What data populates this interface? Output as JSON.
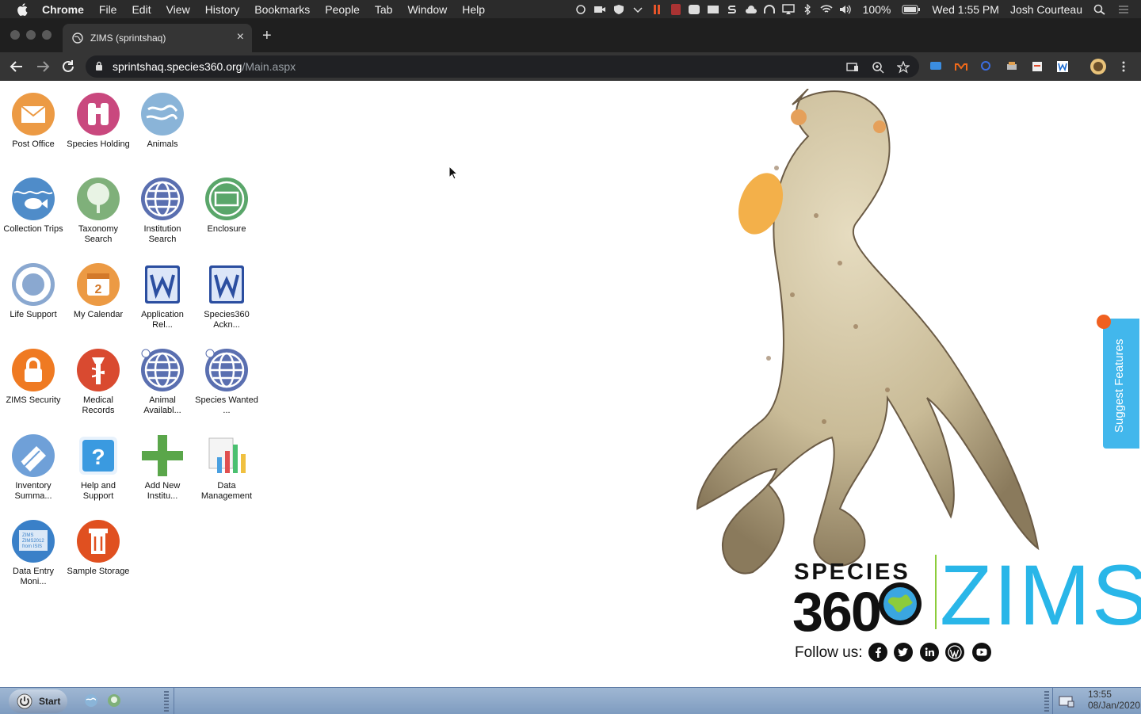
{
  "menubar": {
    "app_name": "Chrome",
    "items": [
      "File",
      "Edit",
      "View",
      "History",
      "Bookmarks",
      "People",
      "Tab",
      "Window",
      "Help"
    ],
    "battery": "100%",
    "datetime": "Wed 1:55 PM",
    "user": "Josh Courteau"
  },
  "browser": {
    "tab_title": "ZIMS (sprintshaq)",
    "url_host": "sprintshaq.species360.org",
    "url_path": "/Main.aspx"
  },
  "apps": [
    {
      "label": "Post Office",
      "icon": "envelope-icon",
      "color": "#e8923a"
    },
    {
      "label": "Species Holding",
      "icon": "binoculars-icon",
      "color": "#c9487e"
    },
    {
      "label": "Animals",
      "icon": "animals-globe-icon",
      "color": "#8ab4d8"
    },
    {
      "label": "Collection Trips",
      "icon": "fish-icon",
      "color": "#4f8cc9"
    },
    {
      "label": "Taxonomy Search",
      "icon": "tree-icon",
      "color": "#7fb07a"
    },
    {
      "label": "Institution Search",
      "icon": "globe-icon",
      "color": "#5a6fb0"
    },
    {
      "label": "Enclosure",
      "icon": "enclosure-globe-icon",
      "color": "#5aa66a"
    },
    {
      "label": "Life Support",
      "icon": "lifebuoy-icon",
      "color": "#8aa8d0"
    },
    {
      "label": "My Calendar",
      "icon": "calendar-icon",
      "color": "#e8923a"
    },
    {
      "label": "Application Rel...",
      "icon": "word-doc-icon",
      "color": "#2b4ea0"
    },
    {
      "label": "Species360 Ackn...",
      "icon": "word-doc-icon",
      "color": "#2b4ea0"
    },
    {
      "label": "ZIMS Security",
      "icon": "padlock-icon",
      "color": "#ef7a22"
    },
    {
      "label": "Medical Records",
      "icon": "medical-icon",
      "color": "#d94a30"
    },
    {
      "label": "Animal Availabl...",
      "icon": "globe-link-icon",
      "color": "#5a6fb0"
    },
    {
      "label": "Species Wanted ...",
      "icon": "globe-link-icon",
      "color": "#5a6fb0"
    },
    {
      "label": "Inventory Summa...",
      "icon": "book-icon",
      "color": "#6fa0d8"
    },
    {
      "label": "Help and Support",
      "icon": "help-icon",
      "color": "#3a9ae0"
    },
    {
      "label": "Add New Institu...",
      "icon": "plus-icon",
      "color": "#5aa64a"
    },
    {
      "label": "Data Management",
      "icon": "chart-icon",
      "color": "#4aa0e0"
    },
    {
      "label": "Data Entry Moni...",
      "icon": "monitor-icon",
      "color": "#3a80c8"
    },
    {
      "label": "Sample Storage",
      "icon": "storage-icon",
      "color": "#e05020"
    }
  ],
  "icon_labels": {
    "data_entry_lines": [
      "ZIMS",
      "ZIMS2012",
      "from ISIS"
    ],
    "calendar_day": "2"
  },
  "branding": {
    "species": "SPECIES",
    "number": "360",
    "product": "ZIMS",
    "follow": "Follow us:",
    "social": [
      "facebook-icon",
      "twitter-icon",
      "linkedin-icon",
      "wordpress-icon",
      "youtube-icon"
    ]
  },
  "suggest": {
    "label": "Suggest Features"
  },
  "taskbar": {
    "start_label": "Start",
    "time": "13:55",
    "date": "08/Jan/2020"
  }
}
